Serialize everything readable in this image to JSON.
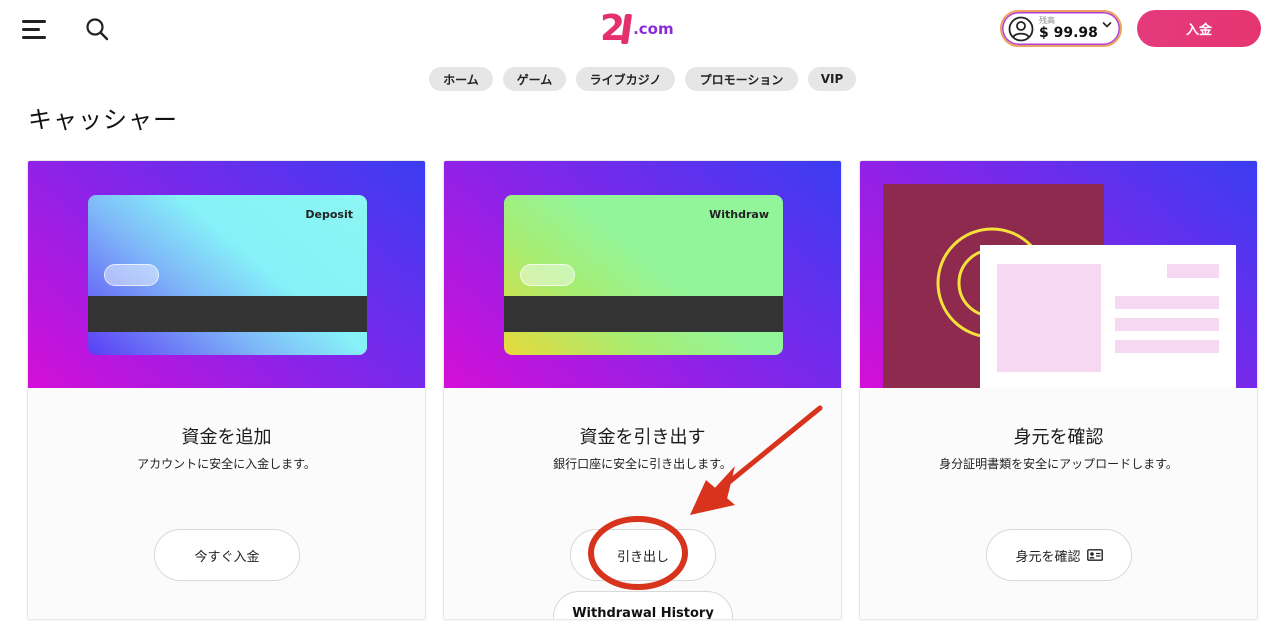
{
  "header": {
    "logo_number": "2",
    "logo_domain": ".com",
    "balance_label": "残高",
    "balance_value": "$ 99.98",
    "deposit_button": "入金"
  },
  "nav": {
    "items": [
      {
        "label": "ホーム"
      },
      {
        "label": "ゲーム"
      },
      {
        "label": "ライブカジノ"
      },
      {
        "label": "プロモーション"
      },
      {
        "label": "VIP"
      }
    ]
  },
  "page": {
    "title": "キャッシャー"
  },
  "cards": [
    {
      "banner_label": "Deposit",
      "title": "資金を追加",
      "description": "アカウントに安全に入金します。",
      "button": "今すぐ入金"
    },
    {
      "banner_label": "Withdraw",
      "title": "資金を引き出す",
      "description": "銀行口座に安全に引き出します。",
      "button": "引き出し",
      "secondary_button": "Withdrawal History"
    },
    {
      "title": "身元を確認",
      "description": "身分証明書類を安全にアップロードします。",
      "button": "身元を確認"
    }
  ],
  "colors": {
    "brand_pink": "#e4306d",
    "brand_purple": "#8b2bd8",
    "annotation_red": "#d8331c"
  },
  "icons": [
    "menu-icon",
    "search-icon",
    "avatar-icon",
    "chevron-down-icon",
    "id-card-icon"
  ]
}
